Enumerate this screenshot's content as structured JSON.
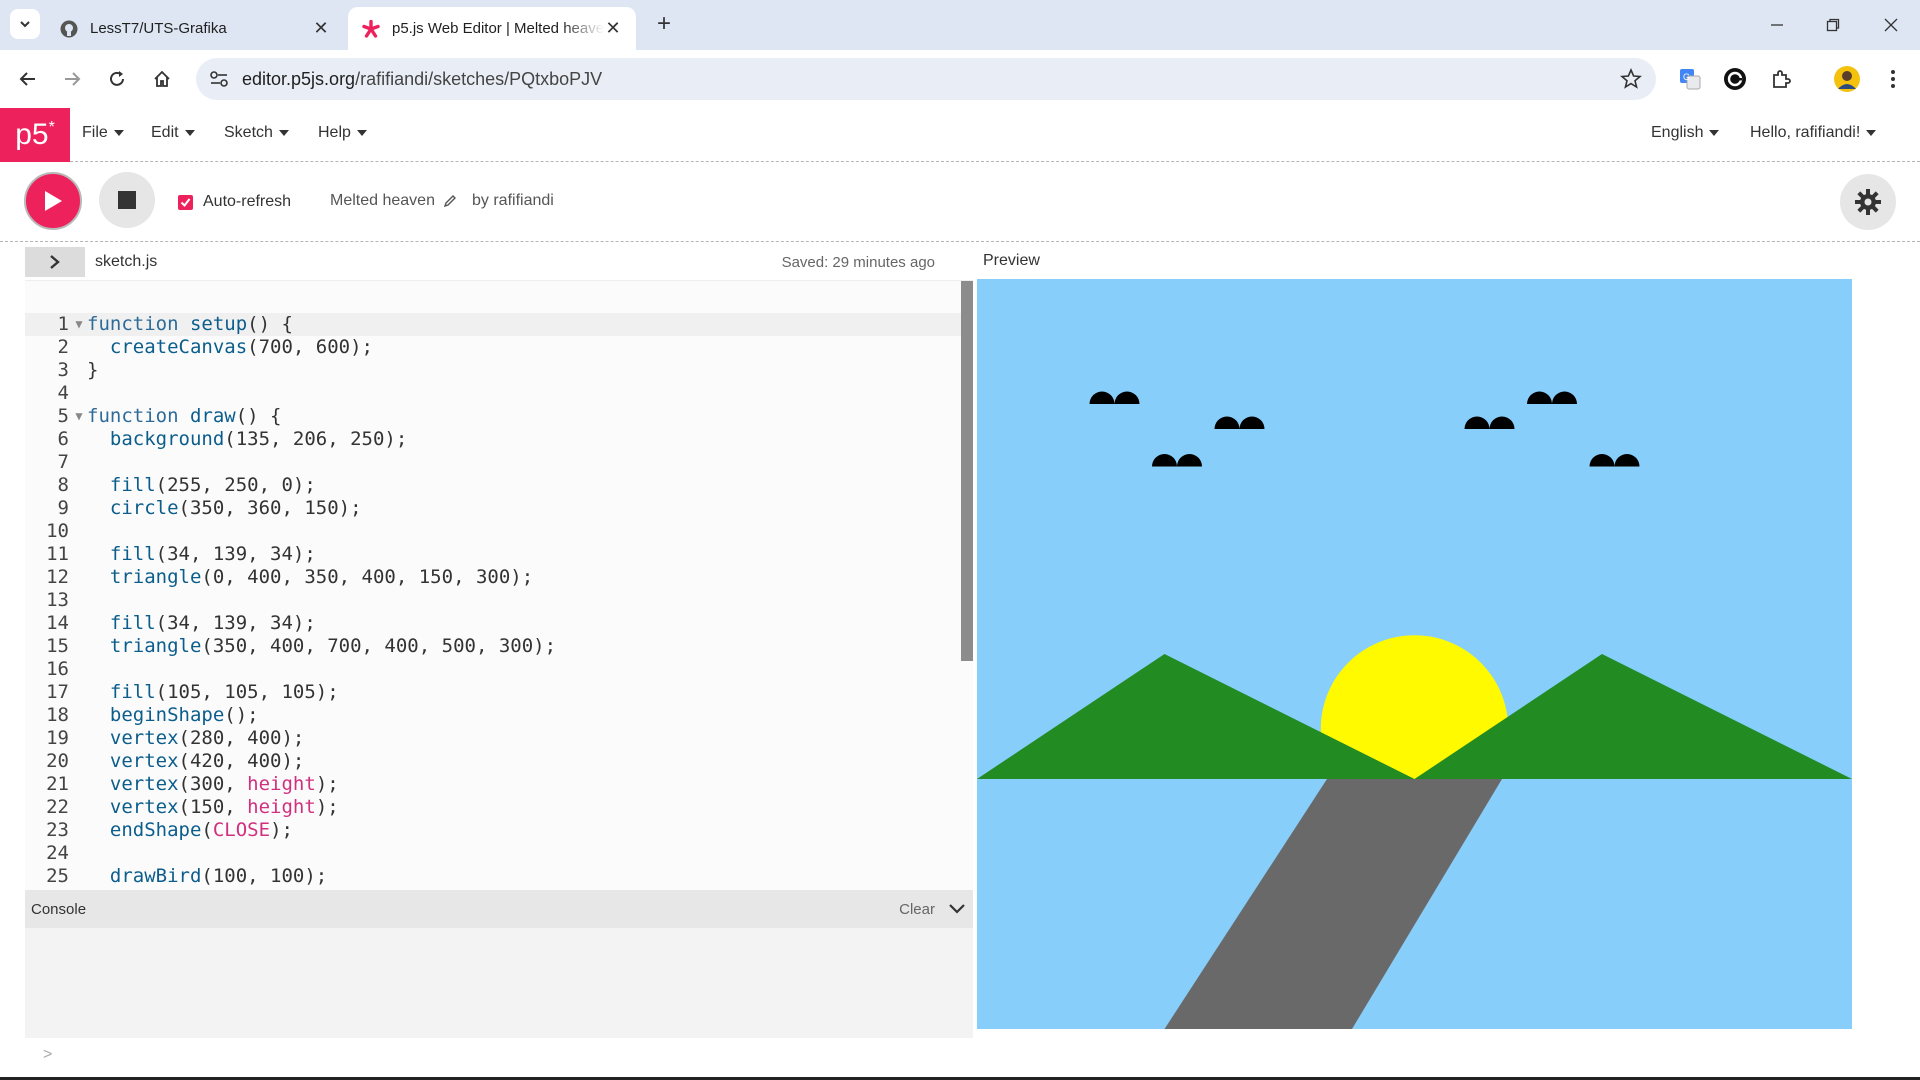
{
  "browser": {
    "tabs": [
      {
        "title": "LessT7/UTS-Grafika",
        "icon": "github-icon"
      },
      {
        "title": "p5.js Web Editor | Melted heaven",
        "icon": "p5-asterisk-icon",
        "active": true
      }
    ],
    "url_domain": "editor.p5js.org",
    "url_path": "/rafifiandi/sketches/PQtxboPJV"
  },
  "p5": {
    "logo": "p5",
    "logo_sup": "*",
    "menu": [
      {
        "label": "File"
      },
      {
        "label": "Edit"
      },
      {
        "label": "Sketch"
      },
      {
        "label": "Help"
      }
    ],
    "language": "English",
    "user_greeting": "Hello, rafifiandi!",
    "auto_refresh_label": "Auto-refresh",
    "auto_refresh_checked": true,
    "sketch_name": "Melted heaven",
    "by_user": "by rafifiandi",
    "filename": "sketch.js",
    "saved_status": "Saved: 29 minutes ago",
    "preview_label": "Preview",
    "console_label": "Console",
    "clear_label": "Clear"
  },
  "code": [
    "function setup() {",
    "  createCanvas(700, 600);",
    "}",
    "",
    "function draw() {",
    "  background(135, 206, 250);",
    "",
    "  fill(255, 250, 0);",
    "  circle(350, 360, 150);",
    "",
    "  fill(34, 139, 34);",
    "  triangle(0, 400, 350, 400, 150, 300);",
    "",
    "  fill(34, 139, 34);",
    "  triangle(350, 400, 700, 400, 500, 300);",
    "",
    "  fill(105, 105, 105);",
    "  beginShape();",
    "  vertex(280, 400);",
    "  vertex(420, 400);",
    "  vertex(300, height);",
    "  vertex(150, height);",
    "  endShape(CLOSE);",
    "",
    "  drawBird(100, 100);"
  ],
  "colors": {
    "p5_pink": "#ed225d",
    "sky": "#87cefa",
    "sun": "#fffa00",
    "mountain": "#228b22",
    "road": "#696969"
  }
}
